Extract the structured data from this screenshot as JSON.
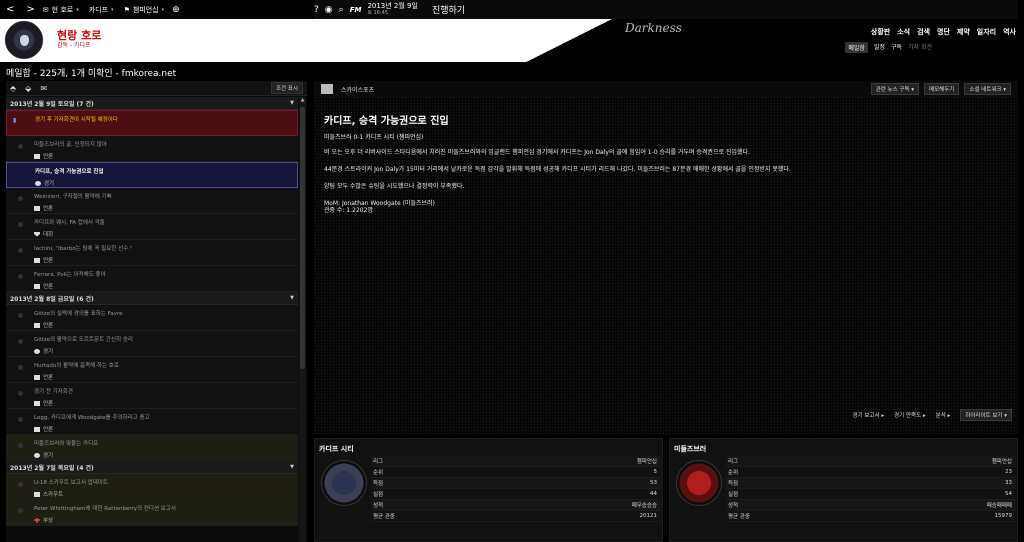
{
  "topbar": {
    "back": "<",
    "forward": ">",
    "menu": [
      {
        "label": "현 호로",
        "icon": "inbox-icon"
      },
      {
        "label": "카디프"
      },
      {
        "label": "챔피언십",
        "icon": "trophy-icon"
      }
    ],
    "date": "2013년 2월 9일",
    "time": "토 16:45",
    "continue_label": "진행하기",
    "fm_label": "FM"
  },
  "header": {
    "club_name": "현랑 호로",
    "club_sub": "감독 - 카디프",
    "skin_name": "Darkness",
    "menu": [
      "상황판",
      "소식",
      "검색",
      "명단",
      "제약",
      "일자리",
      "역사"
    ],
    "submenu": [
      {
        "label": "메일함",
        "active": true
      },
      {
        "label": "일정"
      },
      {
        "label": "구독"
      },
      {
        "label": "기자 회견",
        "dim": true
      }
    ]
  },
  "page_title": "메일함 - 225개, 1개 미확인 - fmkorea.net",
  "left": {
    "filter_label": "조건 표시",
    "groups": [
      {
        "title": "2013년 2월 9일 토요일 (7 건)",
        "items": [
          {
            "title": "경기 후 기자회견이 시작될 예정이다",
            "category": "",
            "style": "red",
            "icon": ""
          },
          {
            "title": "미들즈브러의 골, 인정되지 않아",
            "category": "언론",
            "icon": "news"
          },
          {
            "title": "카디프, 승격 가능권으로 진입",
            "category": "경기",
            "style": "sel",
            "icon": "ball"
          },
          {
            "title": "Weinzierl, 구자철의 활약에 기뻐",
            "category": "언론",
            "icon": "news"
          },
          {
            "title": "카디프와 웨시, FA 컵에서 격돌",
            "category": "대회",
            "icon": "shield"
          },
          {
            "title": "Iachini, \"Ibarbo는 팀에 꼭 필요한 선수.\"",
            "category": "언론",
            "icon": "news"
          },
          {
            "title": "Ferrara, Poli는 이적해도 좋아",
            "category": "언론",
            "icon": "news"
          }
        ]
      },
      {
        "title": "2013년 2월 8일 금요일 (6 건)",
        "items": [
          {
            "title": "Götze의 실력에 경의를 표하는 Favre",
            "category": "언론",
            "icon": "news"
          },
          {
            "title": "Götze의 활약으로 도르트문트 간신히 승리",
            "category": "경기",
            "icon": "ball"
          },
          {
            "title": "Hurtado의 활약에 흡족해 하는 호로",
            "category": "언론",
            "icon": "news"
          },
          {
            "title": "경기 전 기자회견",
            "category": "언론",
            "icon": "news"
          },
          {
            "title": "Legg, 카디프에게 Woodgate를 주의하라고 충고",
            "category": "언론",
            "icon": "news"
          },
          {
            "title": "미들즈브러와 맞붙는 카디프",
            "category": "경기",
            "style": "olive",
            "icon": "ball"
          }
        ]
      },
      {
        "title": "2013년 2월 7일 목요일 (4 건)",
        "items": [
          {
            "title": "U-18 스카우트 보고서 업데이트",
            "category": "스카우트",
            "icon": "news"
          },
          {
            "title": "Peter Whittingham에 대한 Rattenberry의 컨디션 보고서",
            "category": "부상",
            "icon": "cross"
          }
        ]
      }
    ]
  },
  "article": {
    "source": "스카이스포츠",
    "actions": [
      "관련 뉴스 구독 ▾",
      "메모해두기",
      "소셜 네트워크 ▾"
    ],
    "headline": "카디프, 승격 가능권으로 진입",
    "score": "미들즈브러 0-1 카디프 시티 (챔피언십)",
    "para1": "비 오는 오후 더 리버사이드 스타디움에서 치러진 미들즈브러와의 잉글랜드 챔피언십 경기에서 카디프는 Jon Daly의 골에 힘입어 1-0 승리를 거두며 승격권으로 진입했다.",
    "para2": "44분경 스트라이커 Jon Daly가 15미터 거리에서 날카로운 득점 감각을 발휘해 득점에 성공해 카디프 시티가 리드해 나갔다. 미들즈브러는 87분경 애매한 상황에서 골을 인정받지 못했다.",
    "para3": "양팀 모두 수많은 슈팅을 시도했으나 결정력이 부족했다.",
    "mom": "MoM: Jonathan Woodgate (미들즈브러)",
    "attendance": "관중 수: 1.2202명",
    "bottom": [
      "경기 보고서 ▸",
      "경기 만족도 ▸",
      "분석 ▸",
      "하이라이트 보기 ▾"
    ]
  },
  "teams": [
    {
      "name": "카디프 시티",
      "crest": "cardiff",
      "rows": [
        {
          "k": "리그",
          "v": "챔피언십"
        },
        {
          "k": "순위",
          "v": "5"
        },
        {
          "k": "득점",
          "v": "53"
        },
        {
          "k": "실점",
          "v": "44"
        },
        {
          "k": "성적",
          "v": "패무승승승"
        },
        {
          "k": "평균 관중",
          "v": "20121"
        }
      ]
    },
    {
      "name": "미들즈브러",
      "crest": "boro",
      "rows": [
        {
          "k": "리그",
          "v": "챔피언십"
        },
        {
          "k": "순위",
          "v": "23"
        },
        {
          "k": "득점",
          "v": "33"
        },
        {
          "k": "실점",
          "v": "54"
        },
        {
          "k": "성적",
          "v": "패승패패패"
        },
        {
          "k": "평균 관중",
          "v": "15979"
        }
      ]
    }
  ]
}
